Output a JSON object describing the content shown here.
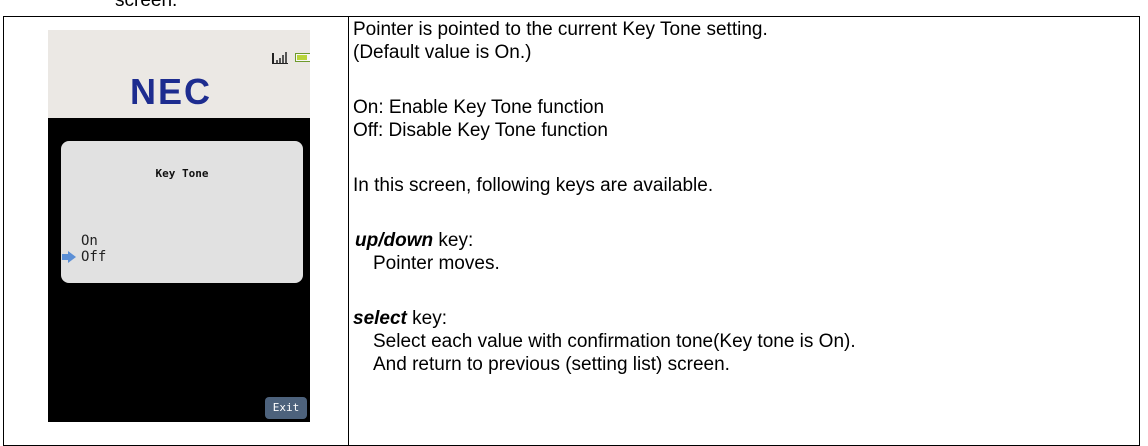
{
  "cut_heading": "screen.",
  "phone": {
    "logo": "NEC",
    "panel_title": "Key Tone",
    "options": [
      "On",
      "Off"
    ],
    "exit_label": "Exit"
  },
  "description": {
    "line1": "Pointer is pointed to the current Key Tone setting.",
    "line2": "(Default value is On.)",
    "on_desc": "On: Enable Key Tone function",
    "off_desc": "Off: Disable Key Tone function",
    "keys_intro": "In this screen, following keys are available.",
    "updown_key": "up/down",
    "updown_suffix": " key:",
    "updown_action": "Pointer moves.",
    "select_key": "select",
    "select_suffix": " key:",
    "select_action1": "Select each value with confirmation tone(Key tone is On).",
    "select_action2": "And return to previous (setting list) screen."
  },
  "colors": {
    "logo": "#1d2c8f",
    "pointer": "#5b8fd6",
    "exit_button": "#4d627c",
    "panel": "#e1e1e1"
  }
}
